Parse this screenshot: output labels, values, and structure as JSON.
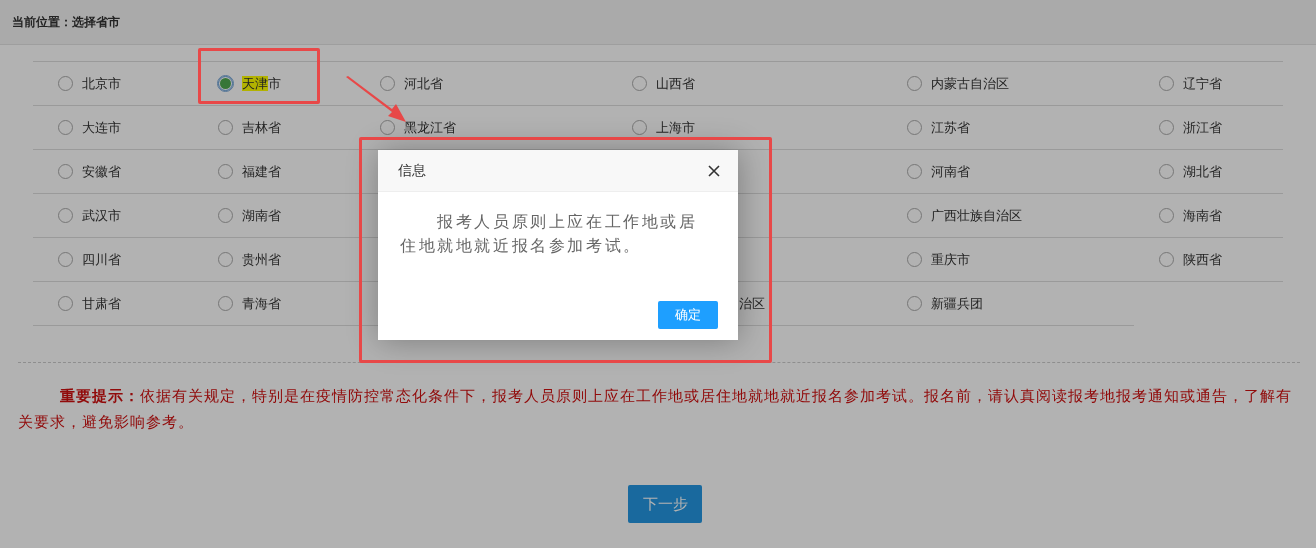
{
  "breadcrumb": "当前位置：选择省市",
  "regions": [
    [
      {
        "kind": "option",
        "parts": [
          {
            "text": "北京市",
            "highlighted": false
          }
        ],
        "selected": false
      },
      {
        "kind": "option",
        "parts": [
          {
            "text": "天津",
            "highlighted": true
          },
          {
            "text": "市",
            "highlighted": false
          }
        ],
        "selected": true
      },
      {
        "kind": "option",
        "parts": [
          {
            "text": "河北省",
            "highlighted": false
          }
        ],
        "selected": false
      },
      {
        "kind": "option",
        "parts": [
          {
            "text": "山西省",
            "highlighted": false
          }
        ],
        "selected": false
      },
      {
        "kind": "option",
        "parts": [
          {
            "text": "内蒙古自治区",
            "highlighted": false
          }
        ],
        "selected": false
      },
      {
        "kind": "option",
        "parts": [
          {
            "text": "辽宁省",
            "highlighted": false
          }
        ],
        "selected": false
      }
    ],
    [
      {
        "kind": "option",
        "parts": [
          {
            "text": "大连市",
            "highlighted": false
          }
        ],
        "selected": false
      },
      {
        "kind": "option",
        "parts": [
          {
            "text": "吉林省",
            "highlighted": false
          }
        ],
        "selected": false
      },
      {
        "kind": "option",
        "parts": [
          {
            "text": "黑龙江省",
            "highlighted": false
          }
        ],
        "selected": false
      },
      {
        "kind": "option",
        "parts": [
          {
            "text": "上海市",
            "highlighted": false
          }
        ],
        "selected": false
      },
      {
        "kind": "option",
        "parts": [
          {
            "text": "江苏省",
            "highlighted": false
          }
        ],
        "selected": false
      },
      {
        "kind": "option",
        "parts": [
          {
            "text": "浙江省",
            "highlighted": false
          }
        ],
        "selected": false
      }
    ],
    [
      {
        "kind": "option",
        "parts": [
          {
            "text": "安徽省",
            "highlighted": false
          }
        ],
        "selected": false
      },
      {
        "kind": "option",
        "parts": [
          {
            "text": "福建省",
            "highlighted": false
          }
        ],
        "selected": false
      },
      {
        "kind": "covered"
      },
      {
        "kind": "covered"
      },
      {
        "kind": "option",
        "parts": [
          {
            "text": "河南省",
            "highlighted": false
          }
        ],
        "selected": false
      },
      {
        "kind": "option",
        "parts": [
          {
            "text": "湖北省",
            "highlighted": false
          }
        ],
        "selected": false
      }
    ],
    [
      {
        "kind": "option",
        "parts": [
          {
            "text": "武汉市",
            "highlighted": false
          }
        ],
        "selected": false
      },
      {
        "kind": "option",
        "parts": [
          {
            "text": "湖南省",
            "highlighted": false
          }
        ],
        "selected": false
      },
      {
        "kind": "covered"
      },
      {
        "kind": "covered"
      },
      {
        "kind": "option",
        "parts": [
          {
            "text": "广西壮族自治区",
            "highlighted": false
          }
        ],
        "selected": false
      },
      {
        "kind": "option",
        "parts": [
          {
            "text": "海南省",
            "highlighted": false
          }
        ],
        "selected": false
      }
    ],
    [
      {
        "kind": "option",
        "parts": [
          {
            "text": "四川省",
            "highlighted": false
          }
        ],
        "selected": false
      },
      {
        "kind": "option",
        "parts": [
          {
            "text": "贵州省",
            "highlighted": false
          }
        ],
        "selected": false
      },
      {
        "kind": "covered"
      },
      {
        "kind": "covered"
      },
      {
        "kind": "option",
        "parts": [
          {
            "text": "重庆市",
            "highlighted": false
          }
        ],
        "selected": false
      },
      {
        "kind": "option",
        "parts": [
          {
            "text": "陕西省",
            "highlighted": false
          }
        ],
        "selected": false
      }
    ],
    [
      {
        "kind": "option",
        "parts": [
          {
            "text": "甘肃省",
            "highlighted": false
          }
        ],
        "selected": false
      },
      {
        "kind": "option",
        "parts": [
          {
            "text": "青海省",
            "highlighted": false
          }
        ],
        "selected": false
      },
      {
        "kind": "covered"
      },
      {
        "kind": "partial",
        "parts": [
          {
            "text": "治区",
            "highlighted": false
          }
        ]
      },
      {
        "kind": "option",
        "parts": [
          {
            "text": "新疆兵团",
            "highlighted": false
          }
        ],
        "selected": false
      }
    ]
  ],
  "notice": "**重要提示：**依据有关规定，特别是在疫情防控常态化条件下，报考人员原则上应在工作地或居住地就地就近报名参加考试。报名前，请认真阅读报考地报考通知或通告，了解有关要求，避免影响参考。",
  "next_button": "下一步",
  "dialog": {
    "title": "信息",
    "message": "报考人员原则上应在工作地或居住地就地就近报名参加考试。",
    "confirm": "确定"
  }
}
